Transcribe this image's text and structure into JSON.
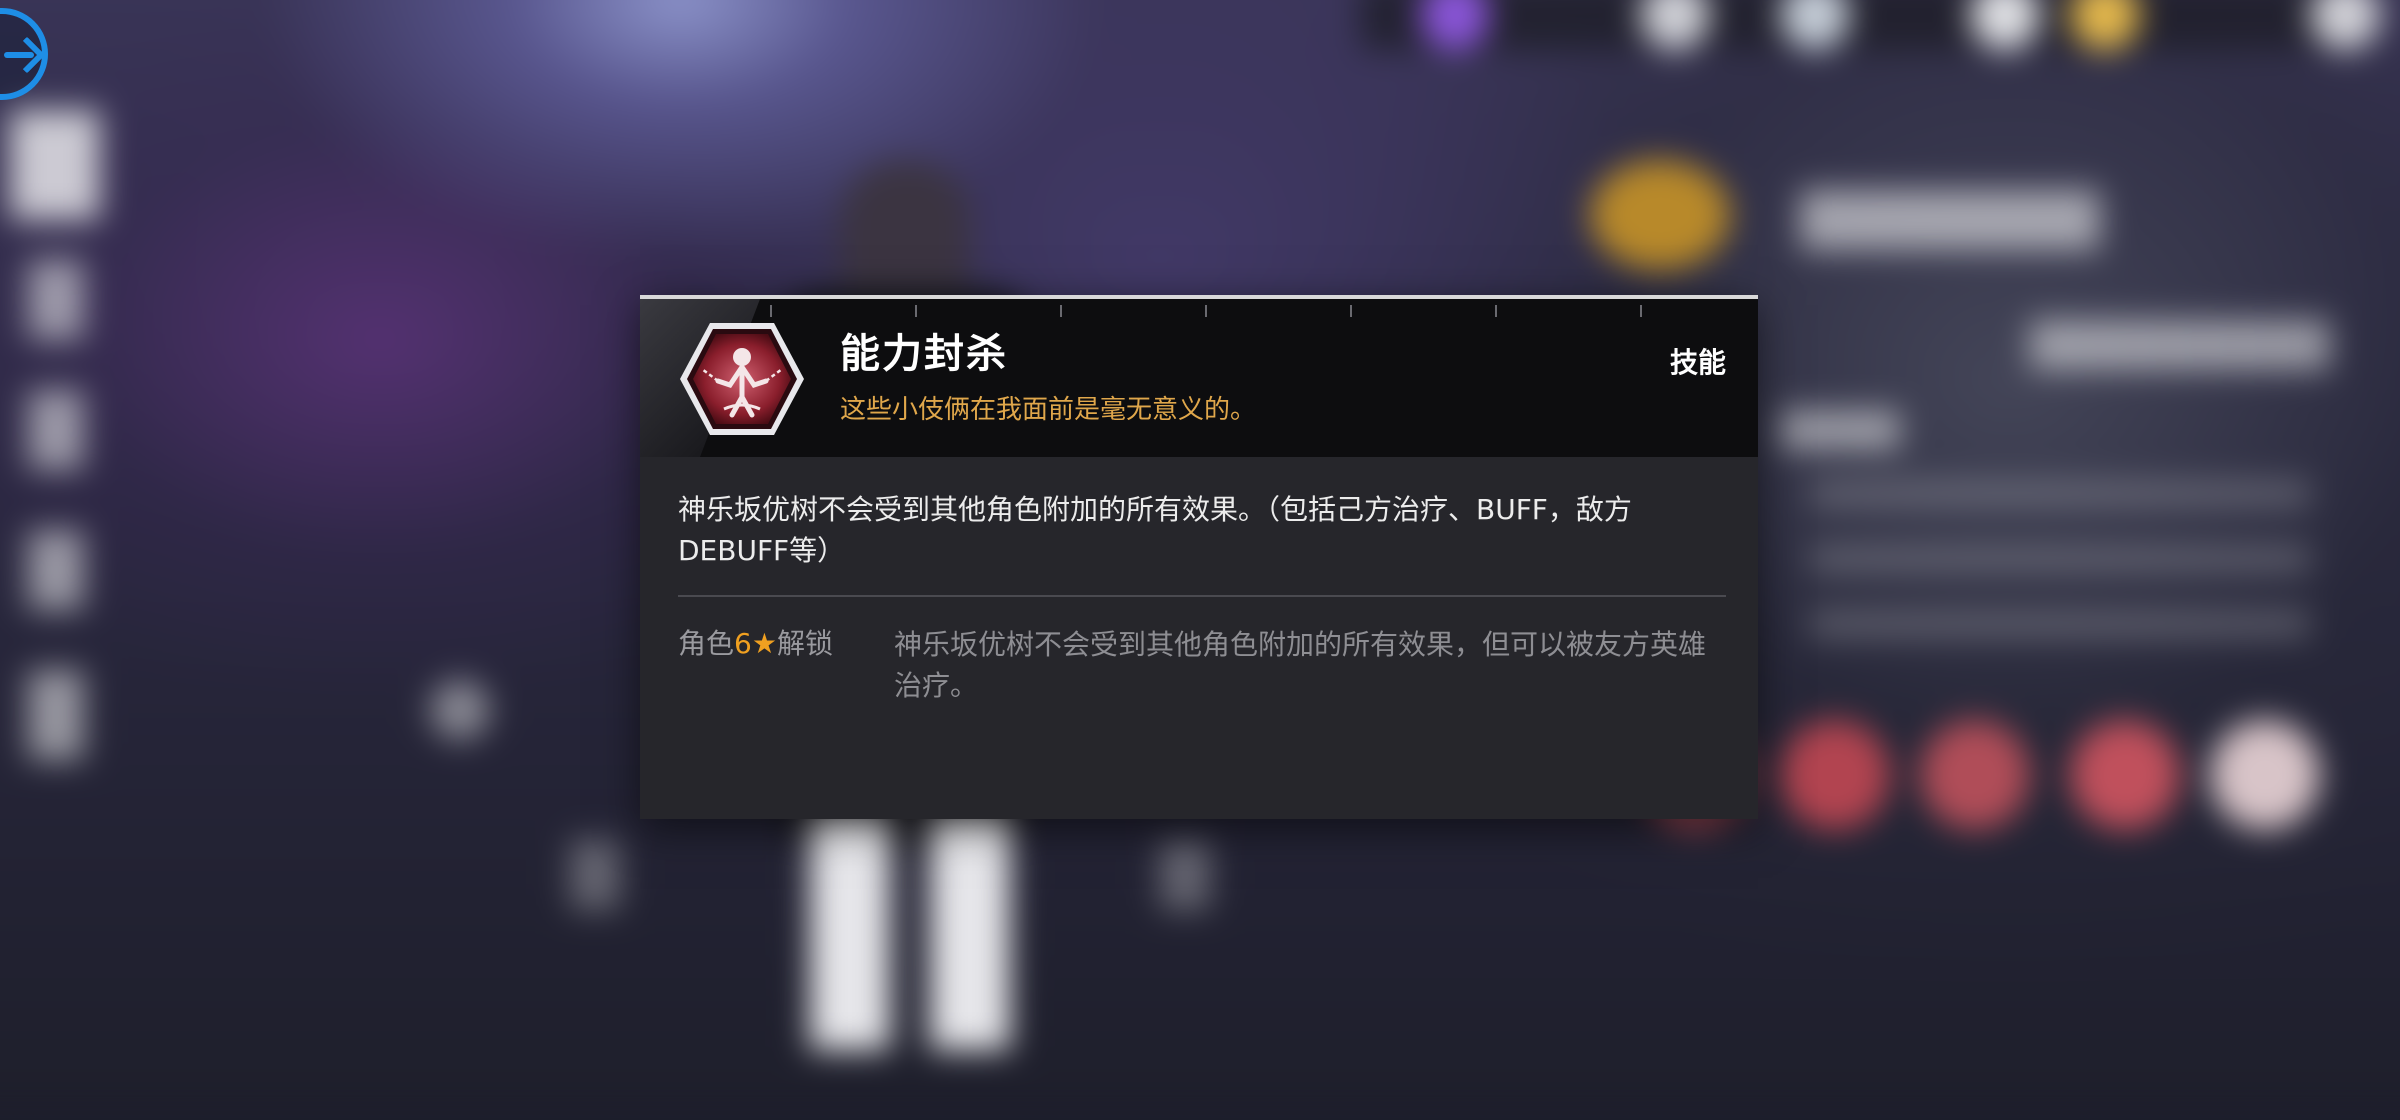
{
  "popup": {
    "skill_name": "能力封杀",
    "skill_quote": "这些小伎俩在我面前是毫无意义的。",
    "skill_type": "技能",
    "description": "神乐坂优树不会受到其他角色附加的所有效果。（包括己方治疗、BUFF，敌方DEBUFF等）",
    "unlock": {
      "prefix": "角色",
      "stars": "6★",
      "suffix": "解锁",
      "description": "神乐坂优树不会受到其他角色附加的所有效果，但可以被友方英雄治疗。"
    }
  },
  "icons": {
    "back": "arrow-right-circle-icon",
    "skill": "chained-figure-hexagon-icon"
  },
  "colors": {
    "accent_blue": "#1e8ee6",
    "quote_gold": "#e0a74b",
    "star_orange": "#f0a020",
    "popup_bg": "#26262b",
    "header_bg": "#0d0d0f"
  }
}
